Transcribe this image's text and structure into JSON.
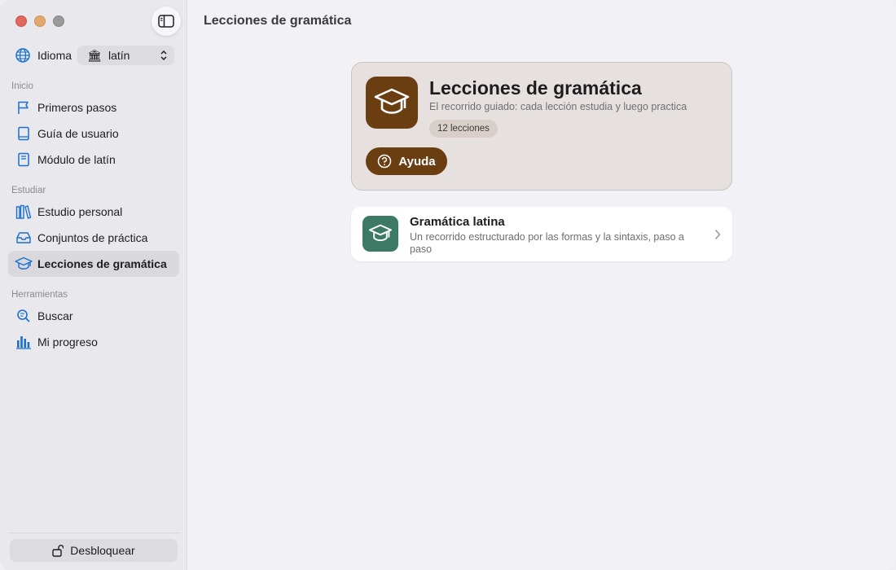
{
  "window": {
    "title": "Lecciones de gramática",
    "traffic_lights": [
      "close",
      "minimize",
      "maximize"
    ]
  },
  "sidebar": {
    "toggle_icon": "sidebar-toggle-icon",
    "language": {
      "label": "Idioma",
      "icon": "globe-icon",
      "selected": "latín",
      "selected_icon": "🏛"
    },
    "sections": [
      {
        "title": "Inicio",
        "items": [
          {
            "label": "Primeros pasos",
            "icon": "flag-icon"
          },
          {
            "label": "Guía de usuario",
            "icon": "book-icon"
          },
          {
            "label": "Módulo de latín",
            "icon": "notebook-icon"
          }
        ]
      },
      {
        "title": "Estudiar",
        "items": [
          {
            "label": "Estudio personal",
            "icon": "books-icon"
          },
          {
            "label": "Conjuntos de práctica",
            "icon": "tray-icon"
          },
          {
            "label": "Lecciones de gramática",
            "icon": "graduation-cap-icon",
            "active": true
          }
        ]
      },
      {
        "title": "Herramientas",
        "items": [
          {
            "label": "Buscar",
            "icon": "search-icon"
          },
          {
            "label": "Mi progreso",
            "icon": "bar-chart-icon"
          }
        ]
      }
    ],
    "unlock_label": "Desbloquear"
  },
  "main": {
    "hero": {
      "title": "Lecciones de gramática",
      "subtitle": "El recorrido guiado: cada lección estudia y luego practica",
      "badge": "12 lecciones",
      "help_label": "Ayuda"
    },
    "courses": [
      {
        "title": "Gramática latina",
        "description": "Un recorrido estructurado por las formas y la sintaxis, paso a paso"
      }
    ]
  },
  "colors": {
    "accent_blue": "#1a6fd1",
    "hero_brown": "#6b3e12",
    "course_green": "#3c7a66"
  }
}
